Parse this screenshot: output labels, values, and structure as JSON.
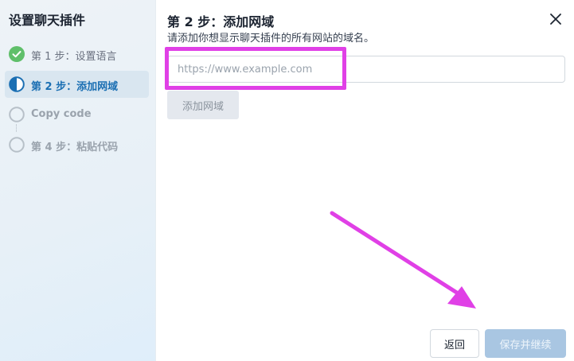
{
  "sidebar": {
    "title": "设置聊天插件",
    "steps": [
      {
        "label": "第 1 步：设置语言",
        "status": "done",
        "icon": "check-circle-icon"
      },
      {
        "label": "第 2 步：添加网域",
        "status": "active",
        "icon": "half-circle-icon"
      },
      {
        "label": "Copy code",
        "status": "todo",
        "icon": "empty-circle-icon"
      },
      {
        "label": "第 4 步：粘贴代码",
        "status": "todo",
        "icon": "empty-circle-icon"
      }
    ]
  },
  "main": {
    "title": "第 2 步：添加网域",
    "subtitle": "请添加你想显示聊天插件的所有网站的域名。",
    "domain_input": {
      "value": "",
      "placeholder": "https://www.example.com"
    },
    "add_button": "添加网域"
  },
  "footer": {
    "back_button": "返回",
    "save_button": "保存并继续"
  },
  "colors": {
    "accent": "#1b6fb3",
    "done": "#5fbf6a",
    "annotation": "#e040e6",
    "save_disabled": "#a9c6e2"
  }
}
